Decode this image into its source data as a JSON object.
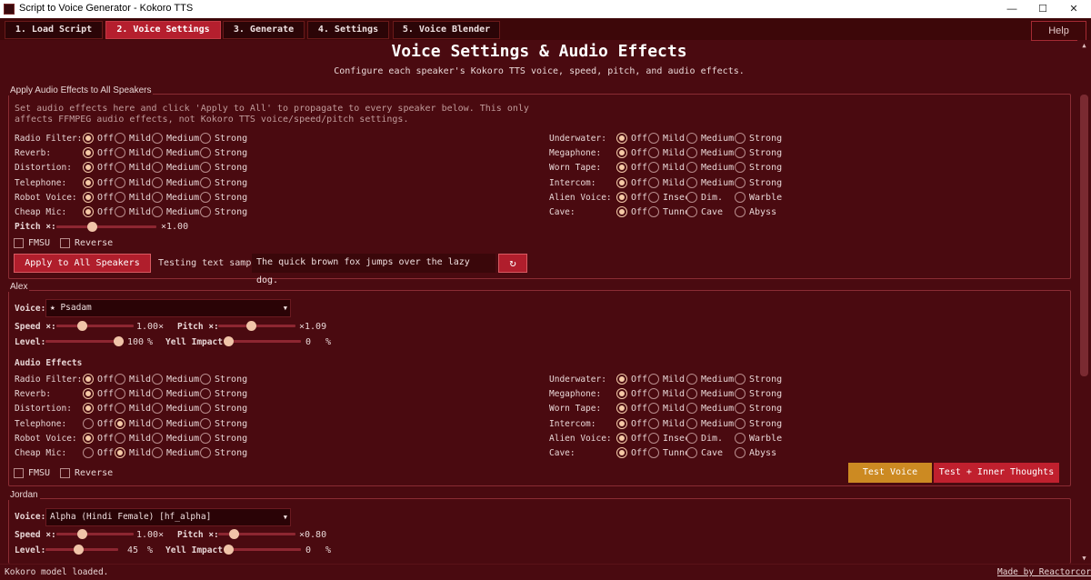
{
  "window": {
    "title": "Script to Voice Generator - Kokoro TTS",
    "controls": [
      "—",
      "☐",
      "✕"
    ]
  },
  "tabs": [
    {
      "label": "1. Load Script"
    },
    {
      "label": "2. Voice Settings"
    },
    {
      "label": "3. Generate"
    },
    {
      "label": "4. Settings"
    },
    {
      "label": "5. Voice Blender"
    }
  ],
  "help_label": "Help",
  "header": {
    "title": "Voice Settings & Audio Effects",
    "subtitle": "Configure each speaker's Kokoro TTS voice, speed, pitch, and audio effects."
  },
  "apply_all": {
    "legend": "Apply Audio Effects to All Speakers",
    "note": "Set audio effects here and click 'Apply to All' to propagate to every speaker below. This only affects FFMPEG audio effects, not Kokoro TTS voice/speed/pitch settings.",
    "left_effects": [
      {
        "label": "Radio Filter:",
        "options": [
          "Off",
          "Mild",
          "Medium",
          "Strong"
        ],
        "selected": 0
      },
      {
        "label": "Reverb:",
        "options": [
          "Off",
          "Mild",
          "Medium",
          "Strong"
        ],
        "selected": 0
      },
      {
        "label": "Distortion:",
        "options": [
          "Off",
          "Mild",
          "Medium",
          "Strong"
        ],
        "selected": 0
      },
      {
        "label": "Telephone:",
        "options": [
          "Off",
          "Mild",
          "Medium",
          "Strong"
        ],
        "selected": 0
      },
      {
        "label": "Robot Voice:",
        "options": [
          "Off",
          "Mild",
          "Medium",
          "Strong"
        ],
        "selected": 0
      },
      {
        "label": "Cheap Mic:",
        "options": [
          "Off",
          "Mild",
          "Medium",
          "Strong"
        ],
        "selected": 0
      }
    ],
    "right_effects": [
      {
        "label": "Underwater:",
        "options": [
          "Off",
          "Mild",
          "Medium",
          "Strong"
        ],
        "selected": 0
      },
      {
        "label": "Megaphone:",
        "options": [
          "Off",
          "Mild",
          "Medium",
          "Strong"
        ],
        "selected": 0
      },
      {
        "label": "Worn Tape:",
        "options": [
          "Off",
          "Mild",
          "Medium",
          "Strong"
        ],
        "selected": 0
      },
      {
        "label": "Intercom:",
        "options": [
          "Off",
          "Mild",
          "Medium",
          "Strong"
        ],
        "selected": 0
      },
      {
        "label": "Alien Voice:",
        "options": [
          "Off",
          "Insect",
          "Dim.",
          "Warble"
        ],
        "selected": 0
      },
      {
        "label": "Cave:",
        "options": [
          "Off",
          "Tunnel",
          "Cave",
          "Abyss"
        ],
        "selected": 0
      }
    ],
    "pitch_label": "Pitch ×:",
    "pitch_value": "×1.00",
    "pitch_fraction": 0.35,
    "fmsu_label": "FMSU",
    "reverse_label": "Reverse",
    "apply_button": "Apply to All Speakers",
    "test_label": "Testing text sample:",
    "test_text": "The quick brown fox jumps over the lazy dog.",
    "refresh_icon": "↻"
  },
  "speakers": [
    {
      "name": "Alex",
      "voice_label": "Voice:",
      "voice_value": "★ Psadam",
      "speed_label": "Speed ×:",
      "speed_value": "1.00×",
      "speed_fraction": 0.33,
      "pitch_label": "Pitch ×:",
      "pitch_value": "×1.09",
      "pitch_fraction": 0.42,
      "level_label": "Level:",
      "level_value": "100",
      "level_unit": "%",
      "level_fraction": 1.0,
      "yell_label": "Yell Impact:",
      "yell_value": "0",
      "yell_unit": "%",
      "yell_fraction": 0.0,
      "effects_heading": "Audio Effects",
      "left_effects": [
        {
          "label": "Radio Filter:",
          "options": [
            "Off",
            "Mild",
            "Medium",
            "Strong"
          ],
          "selected": 0
        },
        {
          "label": "Reverb:",
          "options": [
            "Off",
            "Mild",
            "Medium",
            "Strong"
          ],
          "selected": 0
        },
        {
          "label": "Distortion:",
          "options": [
            "Off",
            "Mild",
            "Medium",
            "Strong"
          ],
          "selected": 0
        },
        {
          "label": "Telephone:",
          "options": [
            "Off",
            "Mild",
            "Medium",
            "Strong"
          ],
          "selected": 1
        },
        {
          "label": "Robot Voice:",
          "options": [
            "Off",
            "Mild",
            "Medium",
            "Strong"
          ],
          "selected": 0
        },
        {
          "label": "Cheap Mic:",
          "options": [
            "Off",
            "Mild",
            "Medium",
            "Strong"
          ],
          "selected": 1
        }
      ],
      "right_effects": [
        {
          "label": "Underwater:",
          "options": [
            "Off",
            "Mild",
            "Medium",
            "Strong"
          ],
          "selected": 0
        },
        {
          "label": "Megaphone:",
          "options": [
            "Off",
            "Mild",
            "Medium",
            "Strong"
          ],
          "selected": 0
        },
        {
          "label": "Worn Tape:",
          "options": [
            "Off",
            "Mild",
            "Medium",
            "Strong"
          ],
          "selected": 0
        },
        {
          "label": "Intercom:",
          "options": [
            "Off",
            "Mild",
            "Medium",
            "Strong"
          ],
          "selected": 0
        },
        {
          "label": "Alien Voice:",
          "options": [
            "Off",
            "Insect",
            "Dim.",
            "Warble"
          ],
          "selected": 0
        },
        {
          "label": "Cave:",
          "options": [
            "Off",
            "Tunnel",
            "Cave",
            "Abyss"
          ],
          "selected": 0
        }
      ],
      "fmsu_label": "FMSU",
      "reverse_label": "Reverse",
      "test_voice": "Test Voice",
      "test_inner": "Test + Inner Thoughts"
    },
    {
      "name": "Jordan",
      "voice_label": "Voice:",
      "voice_value": "Alpha (Hindi Female)  [hf_alpha]",
      "speed_label": "Speed ×:",
      "speed_value": "1.00×",
      "speed_fraction": 0.33,
      "pitch_label": "Pitch ×:",
      "pitch_value": "×0.80",
      "pitch_fraction": 0.2,
      "level_label": "Level:",
      "level_value": "45",
      "level_unit": "%",
      "level_fraction": 0.45,
      "yell_label": "Yell Impact:",
      "yell_value": "0",
      "yell_unit": "%",
      "yell_fraction": 0.0
    }
  ],
  "status": {
    "left": "Kokoro model loaded.",
    "right": "Made by Reactorcore"
  },
  "colors": {
    "background": "#4a0a10",
    "active_tab": "#b51f2e",
    "accent_knob": "#f0c4a8",
    "gold_button": "#cc8a22",
    "crimson_button": "#c0202e"
  }
}
